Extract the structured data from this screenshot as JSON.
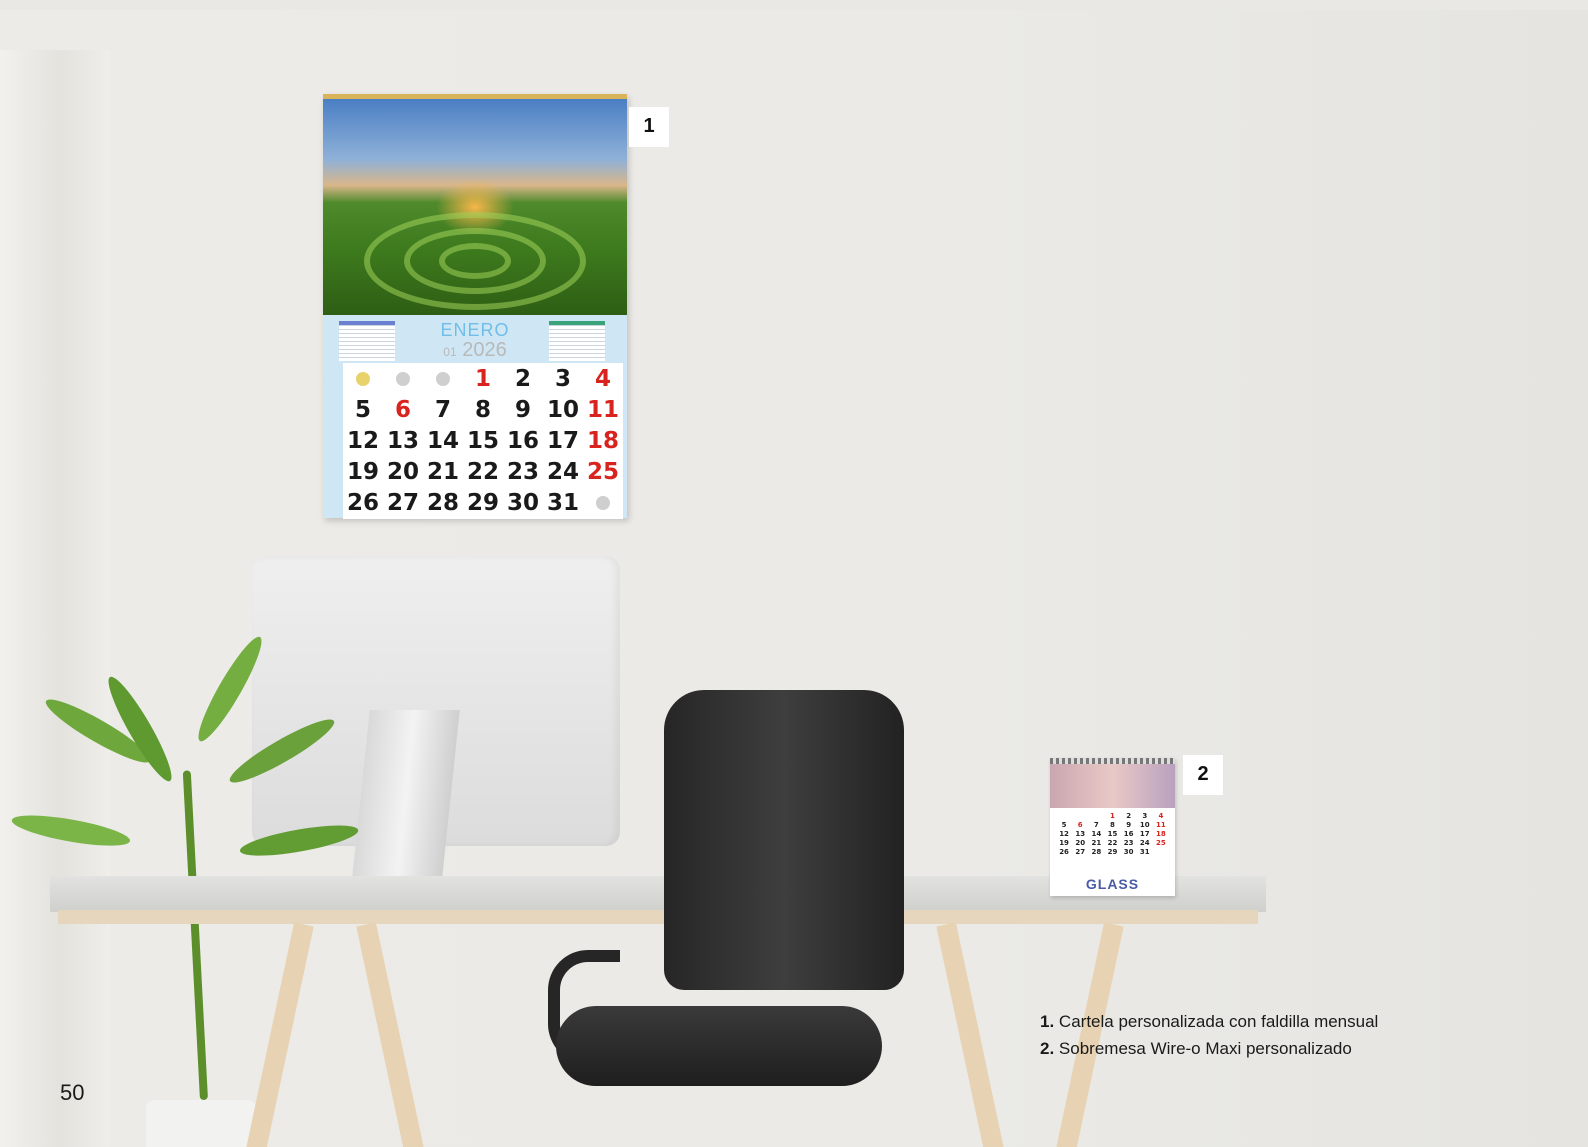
{
  "wall_calendar": {
    "label": "1",
    "month": "ENERO",
    "month_number": "01",
    "year": "2026",
    "weeks": [
      [
        "",
        "",
        "",
        "1",
        "2",
        "3",
        "4"
      ],
      [
        "5",
        "6",
        "7",
        "8",
        "9",
        "10",
        "11"
      ],
      [
        "12",
        "13",
        "14",
        "15",
        "16",
        "17",
        "18"
      ],
      [
        "19",
        "20",
        "21",
        "22",
        "23",
        "24",
        "25"
      ],
      [
        "26",
        "27",
        "28",
        "29",
        "30",
        "31",
        ""
      ]
    ]
  },
  "desk_calendar": {
    "label": "2",
    "brand": "GLASS"
  },
  "captions": [
    {
      "number": "1.",
      "text": "Cartela personalizada con faldilla mensual"
    },
    {
      "number": "2.",
      "text": "Sobremesa Wire-o Maxi personalizado"
    }
  ],
  "page_number": "50"
}
